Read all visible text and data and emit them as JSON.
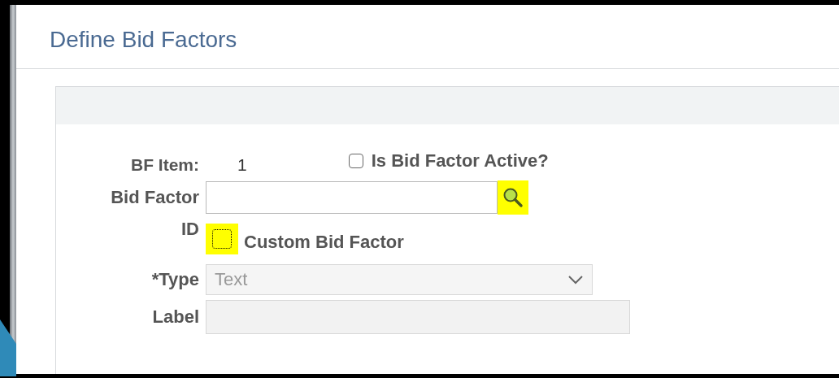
{
  "dialog": {
    "title": "Define Bid Factors"
  },
  "bf_item": {
    "label": "BF Item:",
    "value": "1"
  },
  "active_checkbox": {
    "label": "Is Bid Factor Active?",
    "checked": false
  },
  "bid_factor": {
    "label": "Bid Factor",
    "search_highlighted": true
  },
  "custom_checkbox": {
    "label_left": "ID",
    "label": "Custom Bid Factor",
    "checked": false,
    "highlighted": true
  },
  "type_field": {
    "label": "*Type",
    "value": "Text",
    "disabled": true
  },
  "label_field": {
    "label": "Label",
    "disabled": true
  }
}
